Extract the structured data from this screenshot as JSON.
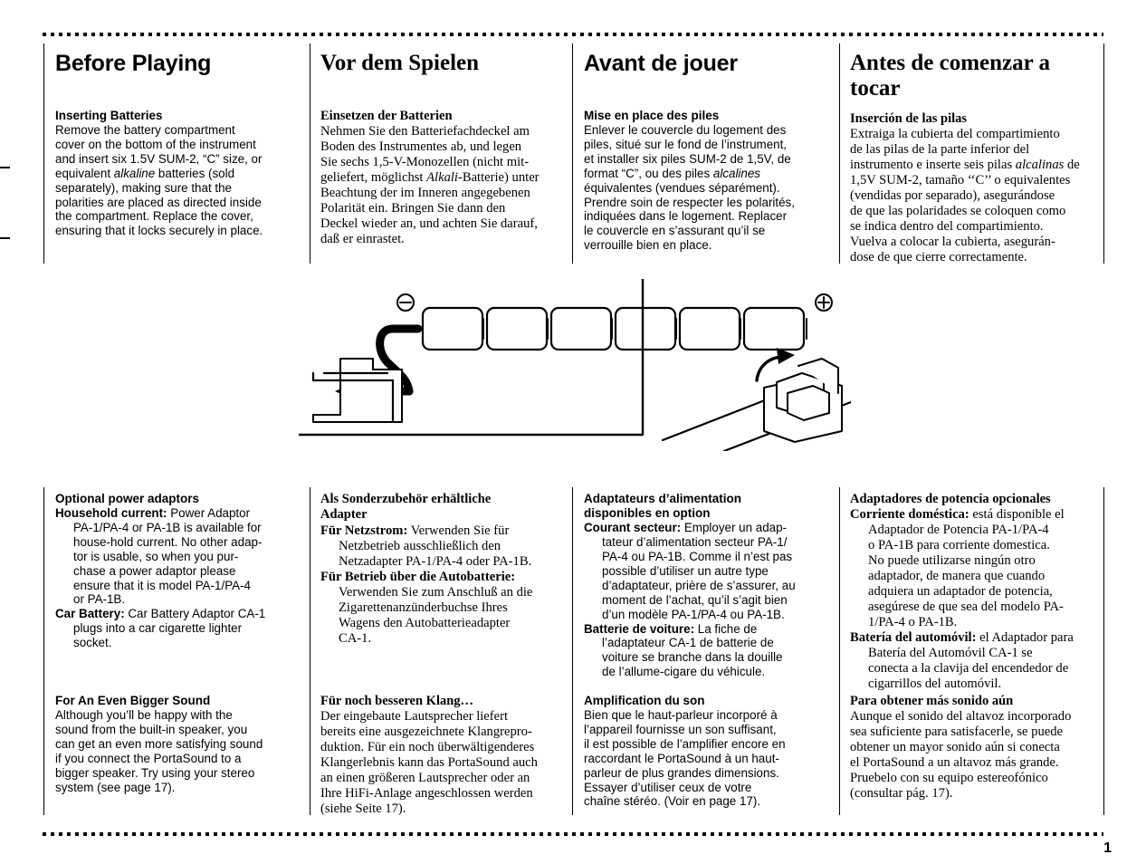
{
  "page": {
    "number": "1"
  },
  "columns": [
    {
      "lang": "en",
      "title": "Before Playing",
      "battery": {
        "heading": "Inserting Batteries",
        "body_pre": "Remove the battery compartment\ncover on the bottom of the instrument\nand insert six 1.5V SUM-2, “C” size, or\nequivalent ",
        "body_italic": "alkaline",
        "body_post": " batteries (sold\nseparately), making sure that the\npolarities are placed as directed inside\nthe compartment. Replace the cover,\nensuring that it locks securely in place."
      },
      "adaptors": {
        "heading": "Optional power adaptors",
        "items": [
          {
            "label": "Household current:",
            "text": " Power Adaptor\nPA-1/PA-4 or PA-1B is available for\nhouse-hold current. No other adap-\ntor is usable, so when you pur-\nchase a power adaptor please\nensure that it is model PA-1/PA-4\nor PA-1B."
          },
          {
            "label": "Car Battery:",
            "text": " Car Battery Adaptor CA-1\nplugs into a car cigarette lighter\nsocket."
          }
        ]
      },
      "bigger": {
        "heading": "For An Even Bigger Sound",
        "body": "Although you’ll be happy with the\nsound from the built-in speaker, you\ncan get an even more satisfying sound\nif you connect the PortaSound to a\nbigger speaker. Try using your stereo\nsystem (see page 17)."
      }
    },
    {
      "lang": "de",
      "title": "Vor dem Spielen",
      "battery": {
        "heading": "Einsetzen der Batterien",
        "body_pre": "Nehmen Sie den Batteriefachdeckel am\nBoden des Instrumentes ab, und legen\nSie sechs 1,5-V-Monozellen (nicht mit-\ngeliefert, möglichst ",
        "body_italic": "Alkali",
        "body_post": "-Batterie) unter\nBeachtung der im Inneren angegebenen\nPolarität ein. Bringen Sie dann den\nDeckel wieder an, und achten Sie darauf,\ndaß er einrastet."
      },
      "adaptors": {
        "heading": "Als Sonderzubehör erhältliche\nAdapter",
        "items": [
          {
            "label": "Für Netzstrom:",
            "text": " Verwenden Sie für\nNetzbetrieb ausschließlich den\nNetzadapter PA-1/PA-4 oder PA-1B."
          },
          {
            "label": "Für Betrieb über die Autobatterie:",
            "text": "\nVerwenden Sie zum Anschluß an die\nZigarettenanzünderbuchse Ihres\nWagens den Autobatterieadapter\nCA-1."
          }
        ]
      },
      "bigger": {
        "heading": "Für noch besseren Klang…",
        "body": "Der eingebaute Lautsprecher liefert\nbereits eine ausgezeichnete Klangrepro-\nduktion. Für ein noch überwältigenderes\nKlangerlebnis kann das PortaSound auch\nan einen größeren Lautsprecher oder an\nIhre HiFi-Anlage angeschlossen werden\n(siehe Seite 17)."
      }
    },
    {
      "lang": "fr",
      "title": "Avant de jouer",
      "battery": {
        "heading": "Mise en place des piles",
        "body_pre": "Enlever le couvercle du logement des\npiles, situé sur le fond de l’instrument,\net installer six piles SUM-2 de 1,5V, de\nformat “C”, ou des piles ",
        "body_italic": "alcalines",
        "body_post": "\néquivalentes (vendues séparément).\nPrendre soin de respecter les polarités,\nindiquées dans le logement. Replacer\nle couvercle en s’assurant qu’il se\nverrouille bien en place."
      },
      "adaptors": {
        "heading": "Adaptateurs d’alimentation\ndisponibles en option",
        "items": [
          {
            "label": "Courant secteur:",
            "text": " Employer un adap-\ntateur d’alimentation secteur PA-1/\nPA-4 ou PA-1B. Comme il n’est pas\npossible d’utiliser un autre type\nd’adaptateur, prière de s’assurer, au\nmoment de l’achat, qu’il s’agit bien\nd’un modèle PA-1/PA-4 ou PA-1B."
          },
          {
            "label": "Batterie de voiture:",
            "text": " La fiche de\nl’adaptateur CA-1 de batterie de\nvoiture se branche dans la douille\nde l’allume-cigare du véhicule."
          }
        ]
      },
      "bigger": {
        "heading": "Amplification du son",
        "body": "Bien que le haut-parleur incorporé à\nl’appareil fournisse un son suffisant,\nil est possible de l’amplifier encore en\nraccordant le PortaSound à un haut-\nparleur de plus grandes dimensions.\nEssayer d’utiliser ceux de votre\nchaîne stéréo. (Voir en page 17)."
      }
    },
    {
      "lang": "es",
      "title": "Antes de comenzar a tocar",
      "battery": {
        "heading": "Inserción de las pilas",
        "body_pre": "Extraiga la cubierta del compartimiento\nde las pilas de la parte inferior del\ninstrumento e inserte seis pilas ",
        "body_italic": "alcalinas",
        "body_post": " de\n1,5V SUM-2, tamaño ‘‘C’’ o equivalentes\n(vendidas por separado), asegurándose\nde que las polaridades se coloquen como\nse indica dentro del compartimiento.\nVuelva a colocar la cubierta, asegurán-\ndose de que cierre correctamente."
      },
      "adaptors": {
        "heading": "Adaptadores de potencia opcionales",
        "items": [
          {
            "label": "Corriente doméstica:",
            "text": " está disponible el\nAdaptador de Potencia PA-1/PA-4\no PA-1B para corriente domestica.\nNo puede utilizarse ningún otro\nadaptador, de manera que cuando\nadquiera un adaptador de potencia,\nasegúrese de que sea del modelo PA-\n1/PA-4 o PA-1B."
          },
          {
            "label": "Batería del automóvil:",
            "text": " el Adaptador para\nBatería del Automóvil CA-1 se\nconecta a la clavija del encendedor de\ncigarrillos del automóvil."
          }
        ]
      },
      "bigger": {
        "heading": "Para obtener más sonido aún",
        "body": "Aunque el sonido del altavoz incorporado\nsea suficiente para satisfacerle, se puede\nobtener un mayor sonido aún si conecta\nel PortaSound a un altavoz más grande.\nPruebelo con su equipo estereofónico\n(consultar pág. 17)."
      }
    }
  ],
  "illustration": {
    "name": "battery-compartment-diagram",
    "minus_symbol": "−",
    "plus_symbol": "+",
    "battery_count": 6,
    "caption": ""
  }
}
